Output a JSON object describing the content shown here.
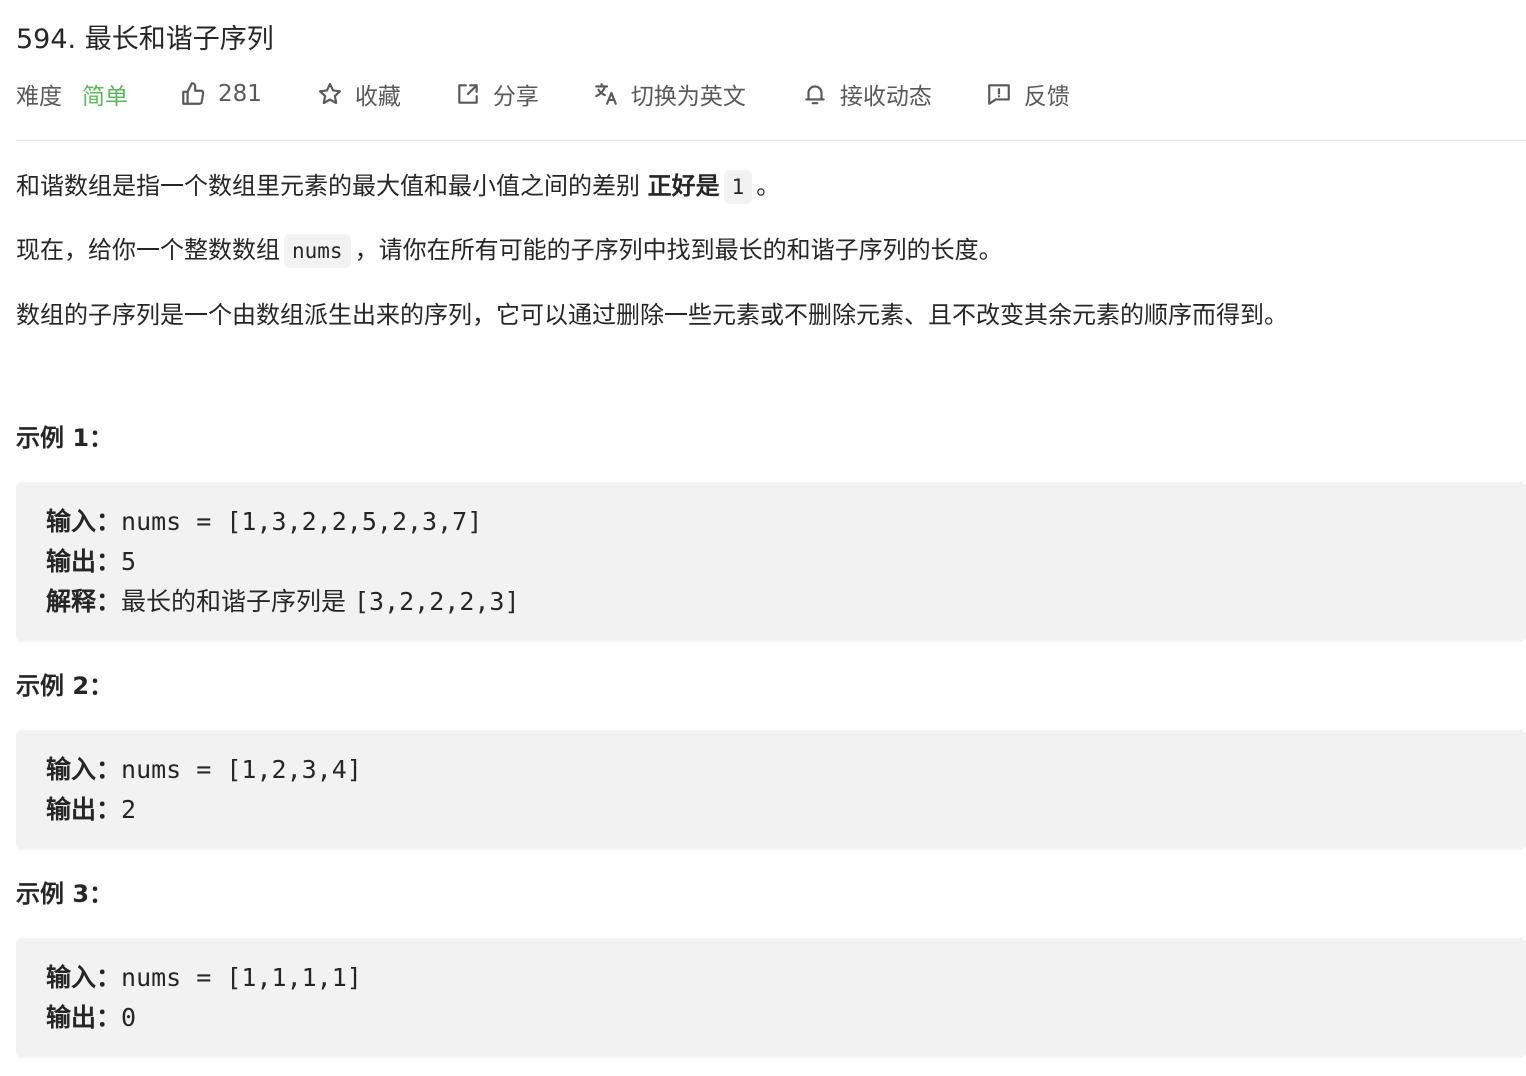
{
  "problem": {
    "title": "594. 最长和谐子序列"
  },
  "meta": {
    "difficulty_label": "难度",
    "difficulty_value": "简单",
    "difficulty_color": "#5cb85c",
    "likes": "281",
    "favorite": "收藏",
    "share": "分享",
    "translate": "切换为英文",
    "subscribe": "接收动态",
    "feedback": "反馈"
  },
  "description": {
    "p1_text": "和谐数组是指一个数组里元素的最大值和最小值之间的差别 ",
    "p1_bold": "正好是",
    "p1_code": "1",
    "p1_end": "。",
    "p2_text": "现在，给你一个整数数组",
    "p2_code": "nums",
    "p2_end": "，请你在所有可能的子序列中找到最长的和谐子序列的长度。",
    "p3_text": "数组的子序列是一个由数组派生出来的序列，它可以通过删除一些元素或不删除元素、且不改变其余元素的顺序而得到。"
  },
  "examples": [
    {
      "title": "示例 1：",
      "input_label": "输入：",
      "input_value": "nums = [1,3,2,2,5,2,3,7]",
      "output_label": "输出：",
      "output_value": "5",
      "explain_label": "解释：",
      "explain_text": "最长的和谐子序列是 ",
      "explain_code": "[3,2,2,2,3]"
    },
    {
      "title": "示例 2：",
      "input_label": "输入：",
      "input_value": "nums = [1,2,3,4]",
      "output_label": "输出：",
      "output_value": "2"
    },
    {
      "title": "示例 3：",
      "input_label": "输入：",
      "input_value": "nums = [1,1,1,1]",
      "output_label": "输出：",
      "output_value": "0"
    }
  ],
  "icons": {
    "like": "thumbs-up-icon",
    "favorite": "star-icon",
    "share": "share-icon",
    "translate": "translate-icon",
    "subscribe": "bell-icon",
    "feedback": "feedback-icon"
  }
}
